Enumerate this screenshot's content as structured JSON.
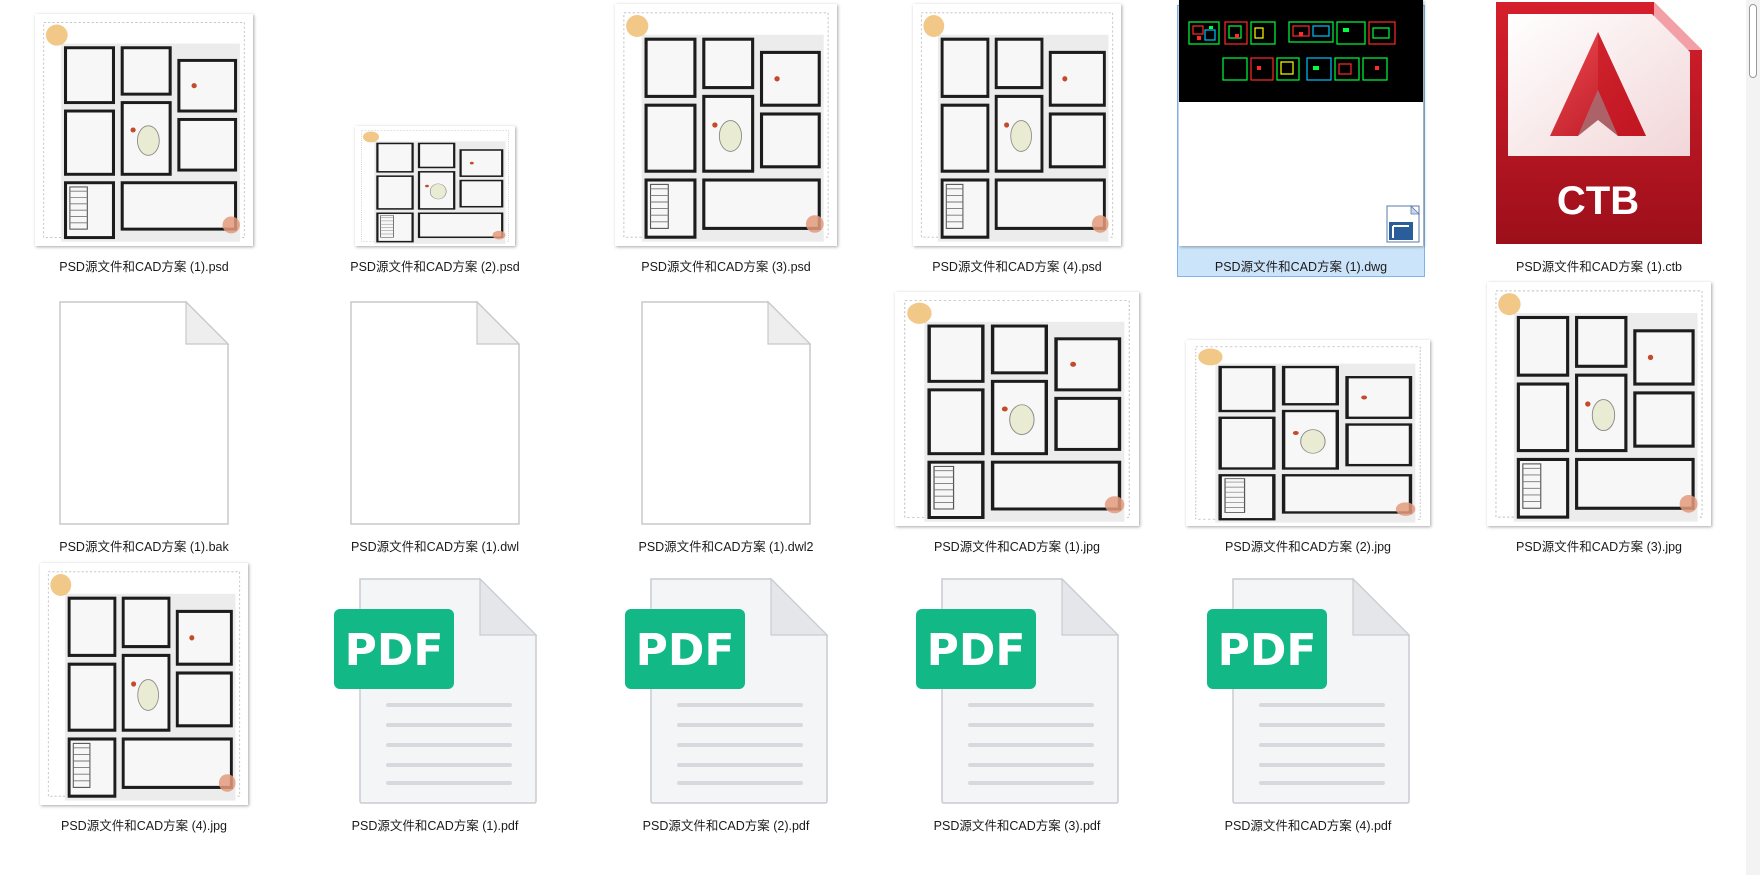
{
  "files": [
    {
      "name": "PSD源文件和CAD方案 (1).psd",
      "icon": "floorplan-thumbnail-icon",
      "selected": false
    },
    {
      "name": "PSD源文件和CAD方案 (2).psd",
      "icon": "floorplan-thumbnail-icon",
      "selected": false
    },
    {
      "name": "PSD源文件和CAD方案 (3).psd",
      "icon": "floorplan-thumbnail-icon",
      "selected": false
    },
    {
      "name": "PSD源文件和CAD方案 (4).psd",
      "icon": "floorplan-thumbnail-icon",
      "selected": false
    },
    {
      "name": "PSD源文件和CAD方案 (1).dwg",
      "icon": "dwg-thumbnail-icon",
      "selected": true
    },
    {
      "name": "PSD源文件和CAD方案 (1).ctb",
      "icon": "autocad-ctb-icon",
      "selected": false,
      "badge": "CTB"
    },
    {
      "name": "PSD源文件和CAD方案 (1).bak",
      "icon": "blank-document-icon",
      "selected": false
    },
    {
      "name": "PSD源文件和CAD方案 (1).dwl",
      "icon": "blank-document-icon",
      "selected": false
    },
    {
      "name": "PSD源文件和CAD方案 (1).dwl2",
      "icon": "blank-document-icon",
      "selected": false
    },
    {
      "name": "PSD源文件和CAD方案 (1).jpg",
      "icon": "floorplan-thumbnail-icon",
      "selected": false
    },
    {
      "name": "PSD源文件和CAD方案 (2).jpg",
      "icon": "floorplan-thumbnail-icon",
      "selected": false
    },
    {
      "name": "PSD源文件和CAD方案 (3).jpg",
      "icon": "floorplan-thumbnail-icon",
      "selected": false
    },
    {
      "name": "PSD源文件和CAD方案 (4).jpg",
      "icon": "floorplan-thumbnail-icon",
      "selected": false
    },
    {
      "name": "PSD源文件和CAD方案 (1).pdf",
      "icon": "pdf-document-icon",
      "selected": false,
      "badge": "PDF"
    },
    {
      "name": "PSD源文件和CAD方案 (2).pdf",
      "icon": "pdf-document-icon",
      "selected": false,
      "badge": "PDF"
    },
    {
      "name": "PSD源文件和CAD方案 (3).pdf",
      "icon": "pdf-document-icon",
      "selected": false,
      "badge": "PDF"
    },
    {
      "name": "PSD源文件和CAD方案 (4).pdf",
      "icon": "pdf-document-icon",
      "selected": false,
      "badge": "PDF"
    }
  ],
  "colors": {
    "selection_bg": "#cce4fa",
    "selection_border": "#7fb4ea",
    "pdf_green": "#12b886",
    "autocad_red": "#c8102e"
  }
}
